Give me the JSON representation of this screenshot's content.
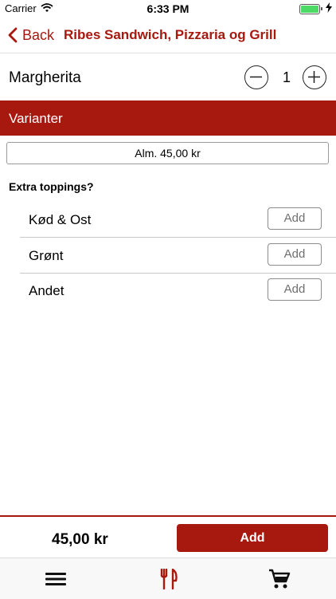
{
  "status_bar": {
    "carrier": "Carrier",
    "time": "6:33 PM"
  },
  "nav": {
    "back_label": "Back",
    "title": "Ribes Sandwich, Pizzaria og Grill"
  },
  "product": {
    "name": "Margherita",
    "quantity": "1"
  },
  "variants": {
    "header": "Varianter",
    "selected": "Alm.  45,00 kr"
  },
  "extras": {
    "title": "Extra toppings?",
    "items": [
      {
        "label": "Kød & Ost",
        "button": "Add"
      },
      {
        "label": "Grønt",
        "button": "Add"
      },
      {
        "label": "Andet",
        "button": "Add"
      }
    ]
  },
  "footer": {
    "total": "45,00 kr",
    "add_label": "Add"
  },
  "colors": {
    "accent": "#a7180f",
    "battery": "#4cd964"
  },
  "tabs": [
    "menu-icon",
    "restaurant-icon",
    "cart-icon"
  ]
}
